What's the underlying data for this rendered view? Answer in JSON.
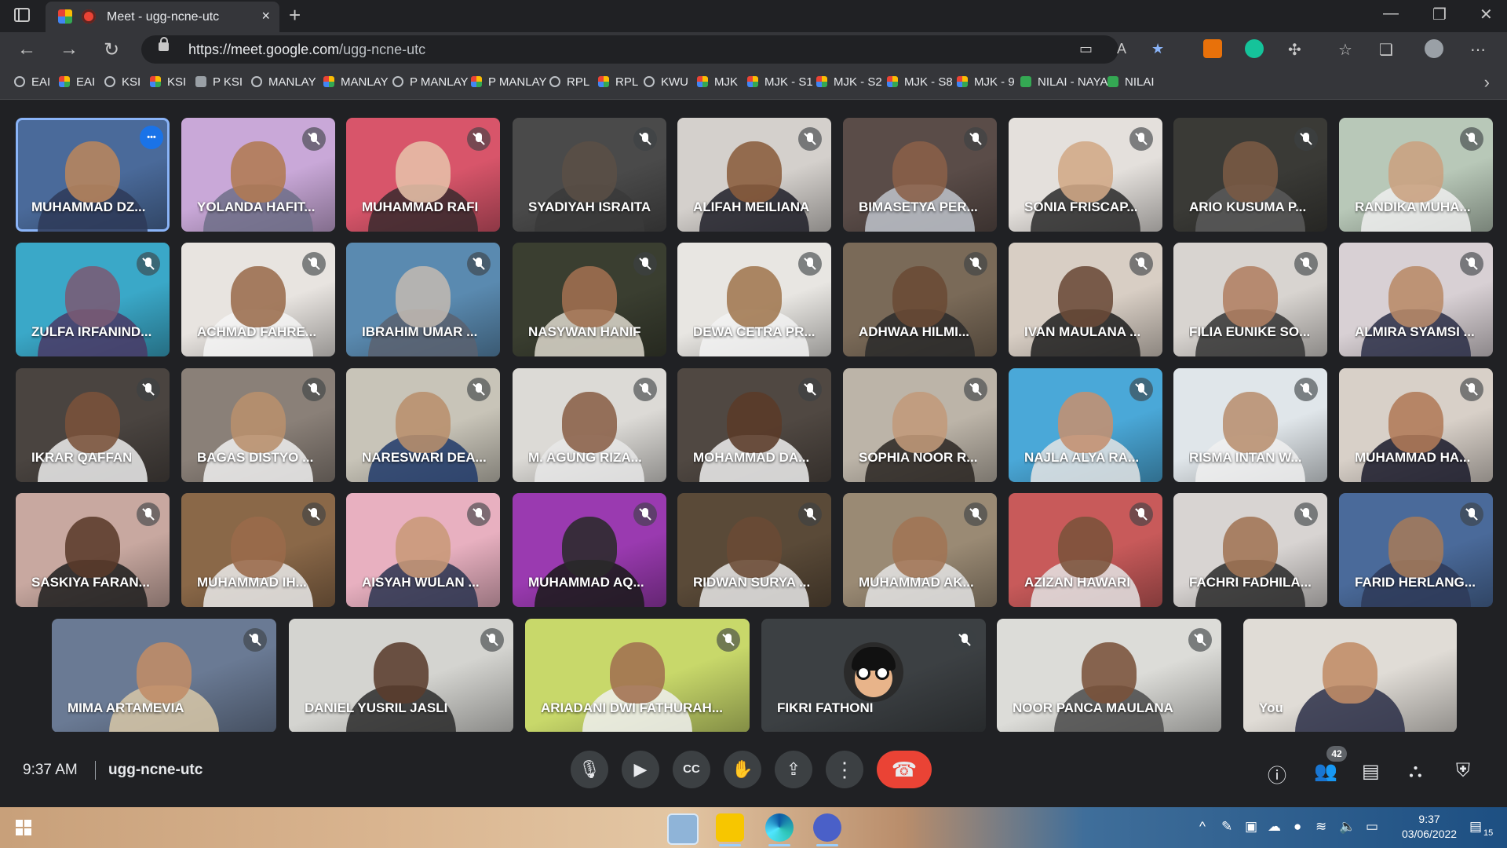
{
  "browser": {
    "tab_title": "Meet - ugg-ncne-utc",
    "tab_close": "×",
    "new_tab": "+",
    "url_host": "https://meet.google.com",
    "url_path": "/ugg-ncne-utc",
    "window_controls": [
      "—",
      "❐",
      "✕"
    ],
    "bookmarks": [
      {
        "label": "EAI",
        "icon": "classroom"
      },
      {
        "label": "EAI",
        "icon": "meet"
      },
      {
        "label": "KSI",
        "icon": "classroom"
      },
      {
        "label": "KSI",
        "icon": "meet"
      },
      {
        "label": "P KSI",
        "icon": "person"
      },
      {
        "label": "MANLAY",
        "icon": "classroom"
      },
      {
        "label": "MANLAY",
        "icon": "meet"
      },
      {
        "label": "P MANLAY",
        "icon": "classroom"
      },
      {
        "label": "P MANLAY",
        "icon": "meet"
      },
      {
        "label": "RPL",
        "icon": "classroom"
      },
      {
        "label": "RPL",
        "icon": "meet"
      },
      {
        "label": "KWU",
        "icon": "classroom"
      },
      {
        "label": "MJK",
        "icon": "meet"
      },
      {
        "label": "MJK - S1",
        "icon": "meet"
      },
      {
        "label": "MJK - S2",
        "icon": "meet"
      },
      {
        "label": "MJK - S8",
        "icon": "meet"
      },
      {
        "label": "MJK - 9",
        "icon": "meet"
      },
      {
        "label": "NILAI - NAYA",
        "icon": "sheets"
      },
      {
        "label": "NILAI",
        "icon": "sheets"
      }
    ]
  },
  "participants": [
    {
      "name": "MUHAMMAD DZ...",
      "bg": "#4a6a9a",
      "skin": "#b8855c",
      "shirt": "#2e3a58"
    },
    {
      "name": "YOLANDA HAFIT...",
      "bg": "#c9a8d8",
      "skin": "#b07a52",
      "shirt": "#6f6f88"
    },
    {
      "name": "MUHAMMAD RAFI",
      "bg": "#d8556a",
      "skin": "#e6c0a8",
      "shirt": "#3a2a2e"
    },
    {
      "name": "SYADIYAH ISRAITA",
      "bg": "#4a4a4a",
      "skin": "#5a4e46",
      "shirt": "#3a3a3a"
    },
    {
      "name": "ALIFAH MEILIANA",
      "bg": "#d4d0cc",
      "skin": "#8a5c3c",
      "shirt": "#1e1e28"
    },
    {
      "name": "BIMASETYA PER...",
      "bg": "#5a4c48",
      "skin": "#8a6048",
      "shirt": "#c0c4cc"
    },
    {
      "name": "SONIA FRISCAP...",
      "bg": "#e4e0dc",
      "skin": "#d2a886",
      "shirt": "#2a2a2a"
    },
    {
      "name": "ARIO KUSUMA P...",
      "bg": "#3a3a36",
      "skin": "#7a5a44",
      "shirt": "#5a5a5a"
    },
    {
      "name": "RANDIKA MUHA...",
      "bg": "#b8c8b8",
      "skin": "#caa080",
      "shirt": "#eeeeee"
    },
    {
      "name": "ZULFA IRFANIND...",
      "bg": "#3aa8c8",
      "skin": "#7a5a74",
      "shirt": "#4a3a66"
    },
    {
      "name": "ACHMAD FAHRE...",
      "bg": "#e8e4e0",
      "skin": "#9a6c4c",
      "shirt": "#f4f4f4"
    },
    {
      "name": "IBRAHIM UMAR ...",
      "bg": "#5a8ab0",
      "skin": "#c0b8b0",
      "shirt": "#5a6270"
    },
    {
      "name": "NASYWAN HANIF",
      "bg": "#3a3e30",
      "skin": "#a07050",
      "shirt": "#ddd8cc"
    },
    {
      "name": "DEWA CETRA PR...",
      "bg": "#e8e6e2",
      "skin": "#a07850",
      "shirt": "#f2f2f2"
    },
    {
      "name": "ADHWAA HILMI...",
      "bg": "#7a6a58",
      "skin": "#6a4a34",
      "shirt": "#2a2a2a"
    },
    {
      "name": "IVAN MAULANA ...",
      "bg": "#d8cec4",
      "skin": "#6a4a38",
      "shirt": "#1e1e1e"
    },
    {
      "name": "FILIA EUNIKE SO...",
      "bg": "#d8d4d0",
      "skin": "#b08062",
      "shirt": "#343434"
    },
    {
      "name": "ALMIRA SYAMSI ...",
      "bg": "#d8d0d4",
      "skin": "#b88a68",
      "shirt": "#2a2e46"
    },
    {
      "name": "IKRAR QAFFAN",
      "bg": "#4a4440",
      "skin": "#7a523a",
      "shirt": "#ececec"
    },
    {
      "name": "BAGAS DISTYO ...",
      "bg": "#8a8078",
      "skin": "#b8906c",
      "shirt": "#f0f0f0"
    },
    {
      "name": "NARESWARI DEA...",
      "bg": "#c8c4b8",
      "skin": "#b8906c",
      "shirt": "#203a6a"
    },
    {
      "name": "M. AGUNG RIZA...",
      "bg": "#dcdad6",
      "skin": "#8a6048",
      "shirt": "#e8e8e8"
    },
    {
      "name": "MOHAMMAD DA...",
      "bg": "#504842",
      "skin": "#5a3a28",
      "shirt": "#eeeeee"
    },
    {
      "name": "SOPHIA NOOR R...",
      "bg": "#bcb4a8",
      "skin": "#c29a7a",
      "shirt": "#2a2622"
    },
    {
      "name": "NAJLA ALYA RA...",
      "bg": "#4aa8d8",
      "skin": "#c49070",
      "shirt": "#e4e4e4"
    },
    {
      "name": "RISMA INTAN W...",
      "bg": "#e0e6ea",
      "skin": "#b89070",
      "shirt": "#f0f0f0"
    },
    {
      "name": "MUHAMMAD HA...",
      "bg": "#d8d0c8",
      "skin": "#b07a58",
      "shirt": "#1a1a2a"
    },
    {
      "name": "SASKIYA FARAN...",
      "bg": "#c8a8a0",
      "skin": "#5a3a2a",
      "shirt": "#1e1e1e"
    },
    {
      "name": "MUHAMMAD IH...",
      "bg": "#8a6848",
      "skin": "#9a6a4a",
      "shirt": "#eaeaea"
    },
    {
      "name": "AISYAH WULAN ...",
      "bg": "#e8b0c0",
      "skin": "#c89878",
      "shirt": "#2a3450"
    },
    {
      "name": "MUHAMMAD AQ...",
      "bg": "#9a3ab0",
      "skin": "#2a2a2a",
      "shirt": "#1a1a1a"
    },
    {
      "name": "RIDWAN SURYA ...",
      "bg": "#5a4a38",
      "skin": "#6a4a34",
      "shirt": "#e8e8e8"
    },
    {
      "name": "MUHAMMAD AK...",
      "bg": "#9a8a74",
      "skin": "#a07454",
      "shirt": "#e4e4e4"
    },
    {
      "name": "AZIZAN HAWARI",
      "bg": "#c85a5a",
      "skin": "#7a523a",
      "shirt": "#e4e4e4"
    },
    {
      "name": "FACHRI FADHILA...",
      "bg": "#d8d4d2",
      "skin": "#a07454",
      "shirt": "#2a2a2a"
    },
    {
      "name": "FARID HERLANG...",
      "bg": "#4a6a9a",
      "skin": "#a47a5a",
      "shirt": "#2e3a58"
    }
  ],
  "bottom_row": [
    {
      "name": "MIMA ARTAMEVIA",
      "bg": "#6a7a94",
      "skin": "#c08c66",
      "shirt": "#d8c8a8",
      "muted": true
    },
    {
      "name": "DANIEL YUSRIL JASLI",
      "bg": "#d4d4d0",
      "skin": "#5a3c2c",
      "shirt": "#2a2a2a",
      "muted": true
    },
    {
      "name": "ARIADANI DWI FATHURAH...",
      "bg": "#c8d86a",
      "skin": "#a07050",
      "shirt": "#f0f0f0",
      "muted": true
    },
    {
      "name": "FIKRI FATHONI",
      "bg": "#3c4043",
      "avatar": true,
      "muted": true
    },
    {
      "name": "NOOR PANCA MAULANA",
      "bg": "#dcdcd8",
      "skin": "#7a523a",
      "shirt": "#4a4a4a",
      "muted": true
    },
    {
      "name": "You",
      "bg": "#e0dcd6",
      "skin": "#c08c66",
      "shirt": "#2a2e46",
      "muted": false
    }
  ],
  "meet": {
    "time": "9:37 AM",
    "code": "ugg-ncne-utc",
    "people_count": "42"
  },
  "taskbar": {
    "clock": "9:37",
    "date": "03/06/2022",
    "notif_count": "15"
  },
  "colors": {
    "end_call": "#ea4335",
    "selected_border": "#8ab4f8",
    "meet_bg": "#202124"
  }
}
